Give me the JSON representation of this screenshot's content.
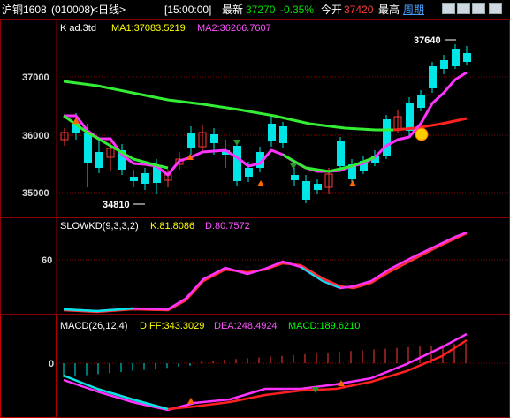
{
  "header": {
    "symbol": "沪铜1608",
    "code": "(010008)",
    "period": "<日线>",
    "time": "[15:00:00]",
    "latest_label": "最新",
    "latest_value": "37270",
    "change_pct": "-0.35%",
    "open_label": "今开",
    "open_value": "37420",
    "high_label": "最高",
    "period_link": "周期"
  },
  "price_panel": {
    "title": "K  ad.3td",
    "ma1": "MA1:37083.5219",
    "ma2": "MA2:36266.7607",
    "y_ticks": [
      "37000",
      "36000",
      "35000"
    ],
    "high_marker": "37640",
    "low_marker": "34810"
  },
  "kd_panel": {
    "title": "SLOWKD(9,3,3,2)",
    "k": "K:81.8086",
    "d": "D:80.7572",
    "y_tick": "60"
  },
  "macd_panel": {
    "title": "MACD(26,12,4)",
    "diff": "DIFF:343.3029",
    "dea": "DEA:248.4924",
    "macd": "MACD:189.6210",
    "y_tick": "0"
  },
  "colors": {
    "up": "#ff3c3c",
    "down": "#00e6e6",
    "ma1": "#ff33ff",
    "ma2": "#33ee33",
    "grid": "#8b0000",
    "accent_yellow": "#ffff00"
  },
  "icons": [
    "prev-page-icon",
    "next-page-icon",
    "zoom-icon",
    "minimize-icon",
    "smiley-icon",
    "buy-arrow-icon",
    "sell-arrow-icon"
  ]
}
